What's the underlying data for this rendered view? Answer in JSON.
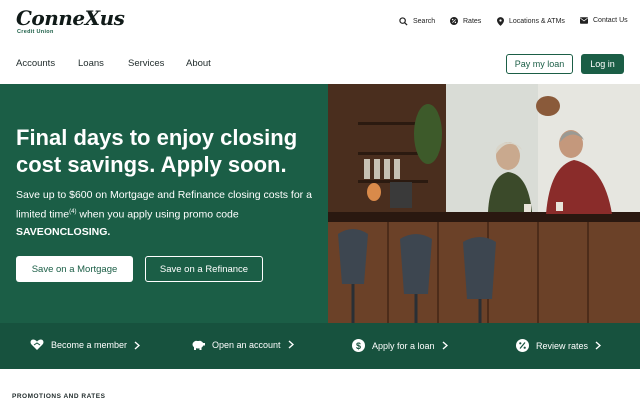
{
  "brand": {
    "logo_text": "ConneXus",
    "logo_subtext": "Credit Union",
    "accent_color": "#1b5e46"
  },
  "utility_nav": [
    {
      "label": "Search",
      "icon": "search-icon"
    },
    {
      "label": "Rates",
      "icon": "rates-icon"
    },
    {
      "label": "Locations & ATMs",
      "icon": "location-pin-icon"
    },
    {
      "label": "Contact Us",
      "icon": "mail-icon"
    }
  ],
  "main_nav": {
    "items": [
      "Accounts",
      "Loans",
      "Services",
      "About"
    ],
    "pay_loan_label": "Pay my loan",
    "login_label": "Log in"
  },
  "hero": {
    "title": "Final days to enjoy closing cost savings. Apply soon.",
    "body_before_note": "Save up to $600 on Mortgage and Refinance closing costs for a limited time",
    "footnote": "(4)",
    "body_after_note": " when you apply using promo code",
    "promo_code": "SAVEONCLOSING.",
    "primary_cta": "Save on a Mortgage",
    "secondary_cta": "Save on a Refinance"
  },
  "quick_links": [
    {
      "label": "Become a member",
      "icon": "handshake-heart-icon"
    },
    {
      "label": "Open an account",
      "icon": "piggy-bank-icon"
    },
    {
      "label": "Apply for a loan",
      "icon": "dollar-circle-icon"
    },
    {
      "label": "Review rates",
      "icon": "percent-circle-icon"
    }
  ],
  "section": {
    "heading": "PROMOTIONS AND RATES"
  }
}
